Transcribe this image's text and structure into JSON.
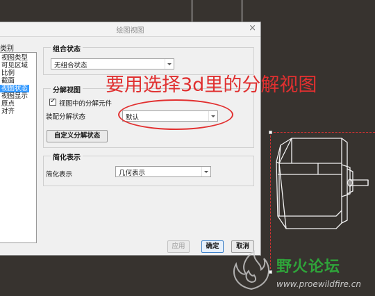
{
  "dialog": {
    "title": "绘图视图",
    "category_label": "类别",
    "categories": [
      {
        "label": "视图类型"
      },
      {
        "label": "可见区域"
      },
      {
        "label": "比例"
      },
      {
        "label": "截面"
      },
      {
        "label": "视图状态",
        "selected": true
      },
      {
        "label": "视图显示"
      },
      {
        "label": "原点"
      },
      {
        "label": "对齐"
      }
    ],
    "combo_state": {
      "title": "组合状态",
      "value": "无组合状态"
    },
    "explode_view": {
      "title": "分解视图",
      "checkbox_label": "视图中的分解元件",
      "checked": true,
      "assembly_label": "装配分解状态",
      "assembly_value": "默认",
      "custom_button": "自定义分解状态"
    },
    "simplified": {
      "title": "简化表示",
      "label": "简化表示",
      "value": "几何表示"
    },
    "buttons": {
      "apply": "应用",
      "ok": "确定",
      "cancel": "取消"
    }
  },
  "annotation": {
    "text": "要用选择3d里的分解视图",
    "color": "#e03030"
  },
  "watermark": {
    "logo_text": "野火论坛",
    "url": "www.proewildfire.cn"
  },
  "colors": {
    "background": "#37332f",
    "selection": "#3399ff",
    "watermark_green": "#2fa43a"
  }
}
